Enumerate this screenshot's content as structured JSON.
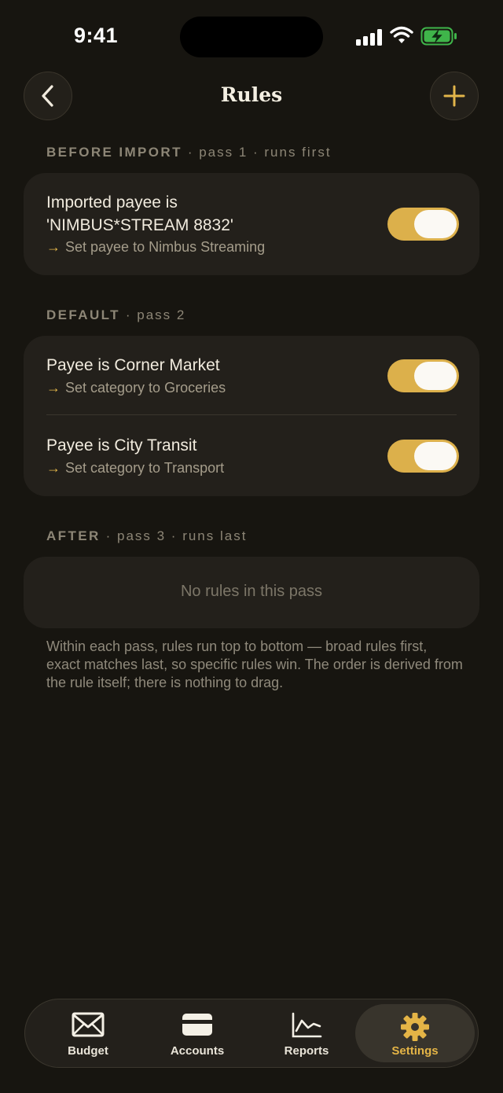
{
  "status_bar": {
    "time": "9:41"
  },
  "header": {
    "title": "Rules"
  },
  "sections": [
    {
      "name": "BEFORE IMPORT",
      "meta": "· pass 1 · runs first",
      "rules": [
        {
          "title_line1": "Imported payee is",
          "title_line2": "'NIMBUS*STREAM 8832'",
          "action": "Set payee to Nimbus Streaming",
          "enabled": true
        }
      ]
    },
    {
      "name": "DEFAULT",
      "meta": "· pass 2",
      "rules": [
        {
          "title": "Payee is Corner Market",
          "action": "Set category to Groceries",
          "enabled": true
        },
        {
          "title": "Payee is City Transit",
          "action": "Set category to Transport",
          "enabled": true
        }
      ]
    },
    {
      "name": "AFTER",
      "meta": "· pass 3 · runs last",
      "empty_text": "No rules in this pass"
    }
  ],
  "footnote": "Within each pass, rules run top to bottom — broad rules first, exact matches last, so specific rules win. The order is derived from the rule itself; there is nothing to drag.",
  "tabbar": {
    "tabs": [
      {
        "label": "Budget",
        "icon": "envelope-icon"
      },
      {
        "label": "Accounts",
        "icon": "card-icon"
      },
      {
        "label": "Reports",
        "icon": "chart-icon"
      },
      {
        "label": "Settings",
        "icon": "gear-icon",
        "active": true
      }
    ]
  },
  "colors": {
    "accent": "#e2b54a",
    "background": "#171510",
    "card": "#23201b",
    "toggle_on": "#dcb04b"
  }
}
